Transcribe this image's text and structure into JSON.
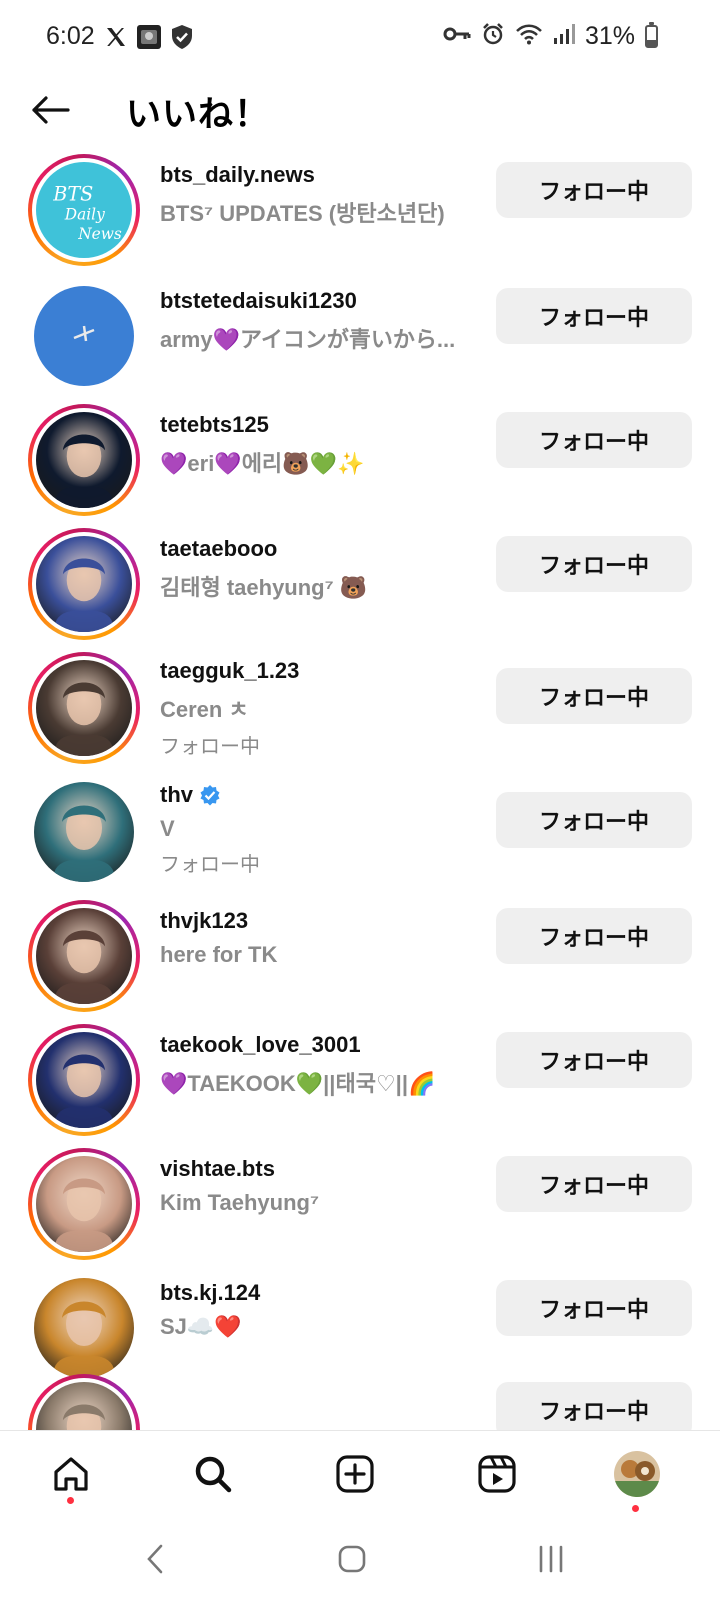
{
  "status_bar": {
    "time": "6:02",
    "battery_text": "31%",
    "battery_level": 0.31
  },
  "header": {
    "title": "いいね！"
  },
  "list": {
    "follow_button_label": "フォロー中",
    "rows": [
      {
        "username": "bts_daily.news",
        "subtitle": "BTS⁷ UPDATES (방탄소년단)",
        "followed_by": "",
        "verified": false,
        "ring": true,
        "avatar_text": "BTS Daily News",
        "avatar_color": "#3fc2d9"
      },
      {
        "username": "btstetedaisuki1230",
        "subtitle": "army💜アイコンが青いから...",
        "followed_by": "",
        "verified": false,
        "ring": false,
        "avatar_text": "",
        "avatar_color": "#3b7fd4"
      },
      {
        "username": "tetebts125",
        "subtitle": "💜eri💜에리🐻💚✨",
        "followed_by": "",
        "verified": false,
        "ring": true,
        "avatar_text": "",
        "avatar_color": "#0f1a2e"
      },
      {
        "username": "taetaebooo",
        "subtitle": "김태형 taehyung⁷ 🐻",
        "followed_by": "",
        "verified": false,
        "ring": true,
        "avatar_text": "",
        "avatar_color": "#3a4f9a"
      },
      {
        "username": "taegguk_1.23",
        "subtitle": "Ceren ㅊ",
        "followed_by": "フォロー中",
        "verified": false,
        "ring": true,
        "avatar_text": "",
        "avatar_color": "#4a3b33"
      },
      {
        "username": "thv",
        "subtitle": "V",
        "followed_by": "フォロー中",
        "verified": true,
        "ring": false,
        "avatar_text": "",
        "avatar_color": "#2f6f7a"
      },
      {
        "username": "thvjk123",
        "subtitle": "here for TK",
        "followed_by": "",
        "verified": false,
        "ring": true,
        "avatar_text": "",
        "avatar_color": "#5a4038"
      },
      {
        "username": "taekook_love_3001",
        "subtitle": "💜TAEKOOK💚||태국♡||🌈",
        "followed_by": "",
        "verified": false,
        "ring": true,
        "avatar_text": "",
        "avatar_color": "#22306e"
      },
      {
        "username": "vishtae.bts",
        "subtitle": "Kim Taehyung⁷",
        "followed_by": "",
        "verified": false,
        "ring": true,
        "avatar_text": "",
        "avatar_color": "#c89a84"
      },
      {
        "username": "bts.kj.124",
        "subtitle": "SJ☁️❤️",
        "followed_by": "",
        "verified": false,
        "ring": false,
        "avatar_text": "",
        "avatar_color": "#c9862c"
      },
      {
        "username": "",
        "subtitle": "",
        "followed_by": "",
        "verified": false,
        "ring": true,
        "avatar_text": "",
        "avatar_color": "#8a7a6a"
      }
    ]
  },
  "bottom_nav": {
    "items": [
      "home-icon",
      "search-icon",
      "create-icon",
      "reels-icon",
      "profile-avatar"
    ],
    "active_dot_color": "#ff3040"
  },
  "system_nav": {
    "items": [
      "back-icon",
      "home-icon",
      "recents-icon"
    ]
  },
  "colors": {
    "verified_blue": "#3897f0",
    "button_gray": "#efefef",
    "subtitle_gray": "#8a8a8a"
  }
}
